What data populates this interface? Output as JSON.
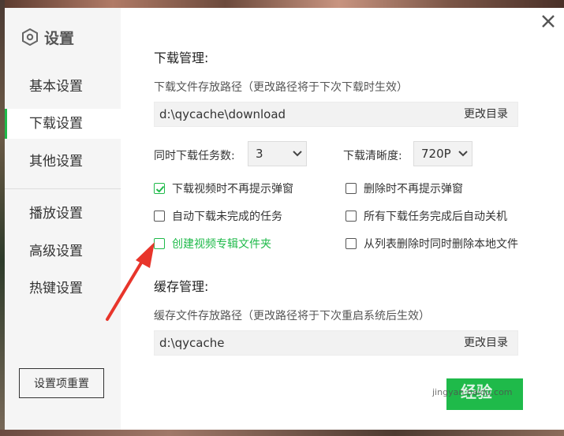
{
  "sidebar": {
    "title": "设置",
    "items": [
      {
        "label": "基本设置"
      },
      {
        "label": "下载设置"
      },
      {
        "label": "其他设置"
      },
      {
        "label": "播放设置"
      },
      {
        "label": "高级设置"
      },
      {
        "label": "热键设置"
      }
    ],
    "active_index": 1,
    "reset_label": "设置项重置"
  },
  "download": {
    "section_title": "下载管理:",
    "path_label": "下载文件存放路径（更改路径将于下次下载时生效）",
    "path_value": "d:\\qycache\\download",
    "change_dir_label": "更改目录",
    "concurrent_label": "同时下载任务数:",
    "concurrent_value": "3",
    "quality_label": "下载清晰度:",
    "quality_value": "720P",
    "options": [
      {
        "label": "下载视频时不再提示弹窗",
        "checked": true
      },
      {
        "label": "删除时不再提示弹窗",
        "checked": false
      },
      {
        "label": "自动下载未完成的任务",
        "checked": false
      },
      {
        "label": "所有下载任务完成后自动关机",
        "checked": false
      },
      {
        "label": "创建视频专辑文件夹",
        "checked": false
      },
      {
        "label": "从列表删除时同时删除本地文件",
        "checked": false
      }
    ]
  },
  "cache": {
    "section_title": "缓存管理:",
    "path_label": "缓存文件存放路径（更改路径将于下次重启系统后生效）",
    "path_value": "d:\\qycache",
    "change_dir_label": "更改目录"
  },
  "watermark": {
    "text": "经验",
    "url": "jingyan.baidu.com"
  },
  "colors": {
    "accent": "#1fba4a",
    "annotation_arrow": "#e8352b"
  },
  "icons": {
    "settings": "hexagon-gear-icon",
    "close": "close-icon",
    "dropdown": "chevron-down-icon",
    "checkbox": "checkmark-icon"
  }
}
